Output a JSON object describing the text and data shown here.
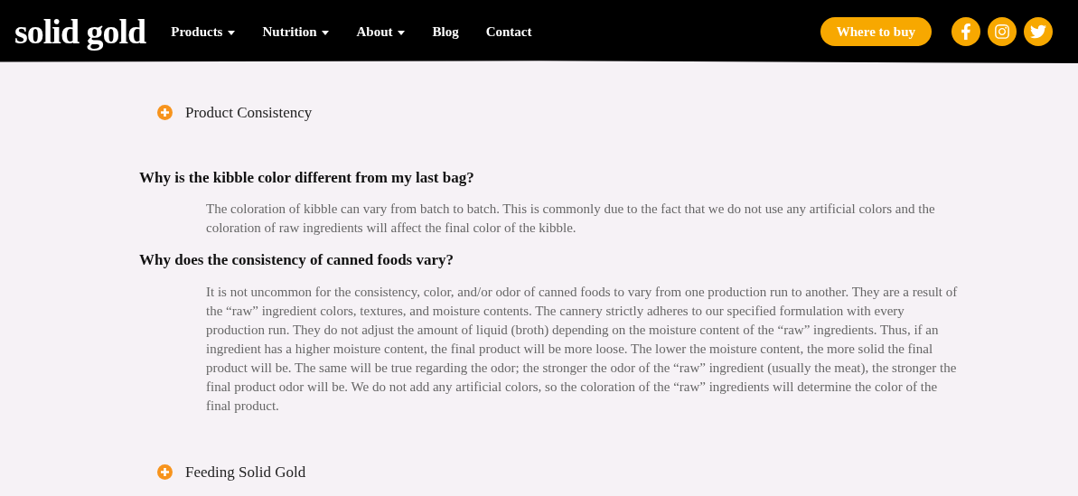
{
  "header": {
    "logo": "solid gold",
    "nav": [
      {
        "label": "Products",
        "dropdown": true
      },
      {
        "label": "Nutrition",
        "dropdown": true
      },
      {
        "label": "About",
        "dropdown": true
      },
      {
        "label": "Blog",
        "dropdown": false
      },
      {
        "label": "Contact",
        "dropdown": false
      }
    ],
    "cta": "Where to buy",
    "social": [
      {
        "kind": "facebook"
      },
      {
        "kind": "instagram"
      },
      {
        "kind": "twitter"
      }
    ]
  },
  "sections": [
    {
      "title": "Product Consistency",
      "faqs": [
        {
          "question": "Why is the kibble color different from my last bag?",
          "answer": "The coloration of kibble can vary from batch to batch. This is commonly due to the fact that we do not use any artificial colors and the coloration of raw ingredients will affect the final color of the kibble."
        },
        {
          "question": "Why does the consistency of canned foods vary?",
          "answer": "It is not uncommon for the consistency, color, and/or odor of canned foods to vary from one production run to another. They are a result of the “raw” ingredient colors, textures, and moisture contents. The cannery strictly adheres to our specified formulation with every production run. They do not adjust the amount of liquid (broth) depending on the moisture content of the “raw” ingredients. Thus, if an ingredient has a higher moisture content, the final product will be more loose. The lower the moisture content, the more solid the final product will be. The same will be true regarding the odor; the stronger the odor of the “raw” ingredient (usually the meat), the stronger the final product odor will be. We do not add any artificial colors, so the coloration of the “raw” ingredients will determine the color of the final product."
        }
      ]
    },
    {
      "title": "Feeding Solid Gold"
    }
  ]
}
